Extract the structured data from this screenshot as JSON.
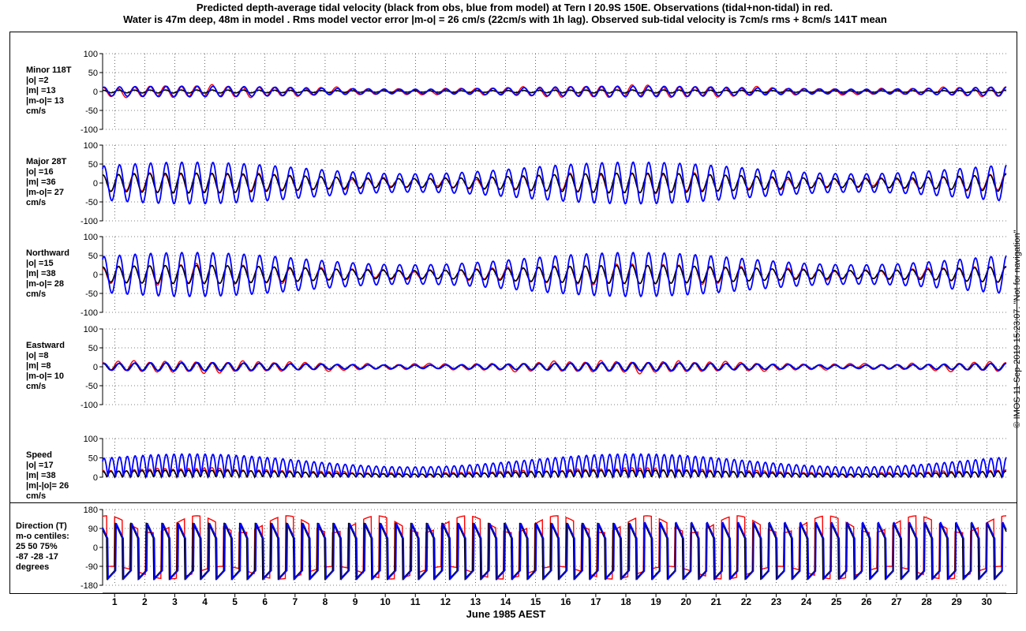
{
  "title": {
    "line1": "Predicted depth-average tidal velocity (black from obs, blue from model) at Tern I 20.9S 150E. Observations (tidal+non-tidal) in red.",
    "line2": "Water is 47m deep, 48m in model . Rms model vector error |m-o| = 26 cm/s (22cm/s with 1h lag). Observed sub-tidal velocity is 7cm/s rms + 8cm/s 141T mean"
  },
  "credit": "© IMOS 11-Sep-2019 15:23:07. \"Not for navigation\"",
  "colors": {
    "obs_tidal": "#000000",
    "model": "#0000ff",
    "observed": "#ff0000",
    "grid": "#000000"
  },
  "chart_data": {
    "type": "line",
    "xlabel": "June 1985 AEST",
    "x_ticks": [
      "1",
      "2",
      "3",
      "4",
      "5",
      "6",
      "7",
      "8",
      "9",
      "10",
      "11",
      "12",
      "13",
      "14",
      "15",
      "16",
      "17",
      "18",
      "19",
      "20",
      "21",
      "22",
      "23",
      "24",
      "25",
      "26",
      "27",
      "28",
      "29",
      "30"
    ],
    "xlim": [
      0.6,
      30.65
    ],
    "series_legend": {
      "black": "from obs",
      "blue": "from model",
      "red": "Observations (tidal+non-tidal)"
    },
    "panels": [
      {
        "id": "minor",
        "label_lines": [
          "Minor 118T",
          "|o| =2",
          "|m| =13",
          "|m-o|= 13",
          "cm/s"
        ],
        "yticks": [
          "-100",
          "-50",
          "0",
          "50",
          "100"
        ],
        "ylim": [
          -100,
          100
        ],
        "amplitude": {
          "obs": 4,
          "model": 14,
          "red": 14
        },
        "phase": {
          "obs": 0.3,
          "model": 0.0,
          "red": 0.4
        }
      },
      {
        "id": "major",
        "label_lines": [
          "Major 28T",
          "|o| =16",
          "|m| =36",
          "|m-o|= 27",
          "cm/s"
        ],
        "yticks": [
          "-100",
          "-50",
          "0",
          "50",
          "100"
        ],
        "ylim": [
          -100,
          100
        ],
        "amplitude": {
          "obs": 26,
          "model": 55,
          "red": 25
        },
        "phase": {
          "obs": 0.4,
          "model": 0.0,
          "red": 0.4
        }
      },
      {
        "id": "northward",
        "label_lines": [
          "Northward",
          "|o| =15",
          "|m| =38",
          "|m-o|= 28",
          "cm/s"
        ],
        "yticks": [
          "-100",
          "-50",
          "0",
          "50",
          "100"
        ],
        "ylim": [
          -100,
          100
        ],
        "amplitude": {
          "obs": 24,
          "model": 58,
          "red": 25
        },
        "phase": {
          "obs": 0.4,
          "model": 0.0,
          "red": 0.4
        }
      },
      {
        "id": "eastward",
        "label_lines": [
          "Eastward",
          "|o| =8",
          "|m| =8",
          "|m-o|= 10",
          "cm/s"
        ],
        "yticks": [
          "-100",
          "-50",
          "0",
          "50",
          "100"
        ],
        "ylim": [
          -100,
          100
        ],
        "amplitude": {
          "obs": 10,
          "model": 11,
          "red": 14
        },
        "phase": {
          "obs": 0.3,
          "model": 0.0,
          "red": 0.5
        }
      },
      {
        "id": "speed",
        "label_lines": [
          "Speed",
          "|o| =17",
          "|m| =38",
          "|m|-|o|= 26",
          "cm/s"
        ],
        "yticks": [
          "0",
          "50",
          "100"
        ],
        "ylim": [
          0,
          100
        ],
        "amplitude": {
          "obs": 18,
          "model": 60,
          "red": 22
        },
        "phase": {
          "obs": 0.4,
          "model": 0.0,
          "red": 0.4
        }
      },
      {
        "id": "direction",
        "label_lines": [
          "Direction (T)",
          "m-o centiles:",
          "25  50  75%",
          "-87 -28 -17",
          "degrees"
        ],
        "yticks": [
          "-180",
          "-90",
          "0",
          "90",
          "180"
        ],
        "ylim": [
          -180,
          180
        ]
      }
    ]
  }
}
